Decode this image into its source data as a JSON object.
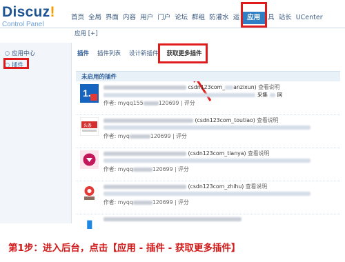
{
  "header": {
    "brand": "Discuz",
    "brand_mark": "!",
    "subtitle": "Control Panel",
    "nav": [
      "首页",
      "全局",
      "界面",
      "内容",
      "用户",
      "门户",
      "论坛",
      "群组",
      "防灌水",
      "运"
    ],
    "nav_active": "应用",
    "nav_after": [
      "具",
      "站长",
      "UCenter"
    ]
  },
  "breadcrumb": "应用 [+]",
  "sidebar": {
    "items": [
      {
        "label": "应用中心"
      },
      {
        "label": "插件"
      }
    ]
  },
  "tabs": [
    "插件",
    "插件列表",
    "设计新插件",
    "获取更多插件"
  ],
  "section": {
    "title": "未启用的插件"
  },
  "plugins": [
    {
      "id_text": "csdn123com_",
      "id_tail": "anzixun)",
      "link": "查看说明",
      "author": "作者: myqq155",
      "author_tail": "120699 | 评分"
    },
    {
      "id_text": "(csdn123com_toutiao)",
      "link": "查看说明",
      "author": "作者: myq",
      "author_tail": "120699 | 评分"
    },
    {
      "id_text": "(csdn123com_tianya)",
      "link": "查看说明",
      "author": "作者: myqq",
      "author_tail": "120699 | 评分"
    },
    {
      "id_text": "(csdn123com_zhihu)",
      "link": "查看说明",
      "author": "作者: myqq",
      "author_tail": "120699 | 评分"
    }
  ],
  "plugin_extra": {
    "collect": "采集",
    "net": "网"
  },
  "caption": "第1步：进入后台，点击【应用 - 插件 - 获取更多插件】"
}
